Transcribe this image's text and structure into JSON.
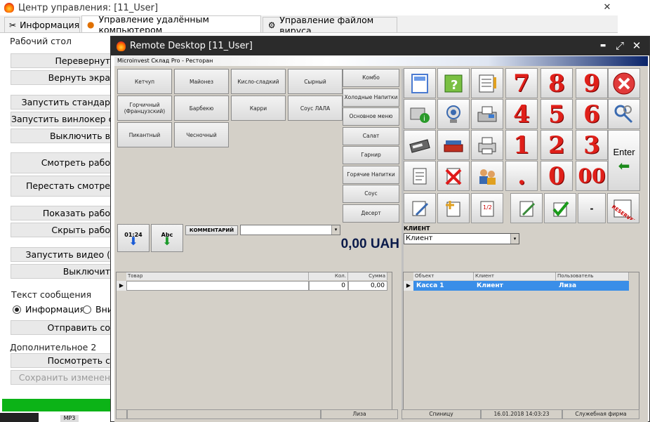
{
  "back_window": {
    "title": "Центр управления: [11_User]",
    "controls": {
      "close": "✕"
    },
    "tabs": [
      {
        "label": "Информация",
        "icon": "tools-icon"
      },
      {
        "label": "Управление удалённым компьютером",
        "icon": "pumpkin-icon"
      },
      {
        "label": "Управление файлом вируса",
        "icon": "gear-icon"
      }
    ],
    "groups": {
      "desktop": "Рабочий стол",
      "message": "Текст сообщения",
      "extra": "Дополнительное 2"
    },
    "buttons": [
      "Перевернут",
      "Вернуть экра",
      "Запустить стандар",
      "Запустить винлокер с",
      "Выключить в",
      "Смотреть рабо",
      "Перестать смотре",
      "Показать рабо",
      "Скрыть рабо",
      "Запустить видео (",
      "Выключит",
      "Отправить со",
      "Посмотреть с",
      "Сохранить изменен"
    ],
    "radio": {
      "selected": "Информация",
      "other": "Вни"
    },
    "taskbar": {
      "label": "MP3"
    },
    "progress_percent": 100
  },
  "rd_window": {
    "title": "Remote Desktop [11_User]",
    "controls": {
      "minimize": "▬",
      "maximize": "⤢",
      "close": "✕"
    },
    "app_title": "Microinvest Склад Pro - Ресторан",
    "products": [
      [
        "Кетчуп",
        "Майонез",
        "Кисло-сладкий",
        "Сырный"
      ],
      [
        "Горчичный (Французский)",
        "Барбекю",
        "Карри",
        "Соус ЛАЛА"
      ],
      [
        "Пикантный",
        "Чесночный"
      ]
    ],
    "categories": [
      "Комбо",
      "Холодные Напитки",
      "Основное меню",
      "Салат",
      "Гарнир",
      "Горячие Напитки",
      "Соус",
      "Десерт"
    ],
    "sort_buttons": {
      "num": "01:24",
      "alpha": "Abc"
    },
    "comment_label": "КОММЕНТАРИЙ",
    "total": "0,00 UAH",
    "client_label": "КЛИЕНТ",
    "client_value": "Клиент",
    "order_grid": {
      "headers": [
        "Товар",
        "Кол.",
        "Сумма"
      ],
      "row": {
        "item": "",
        "qty": "0",
        "sum": "0,00"
      }
    },
    "objects_grid": {
      "headers": [
        "Объект",
        "Клиент",
        "Пользователь"
      ],
      "row": {
        "object": "Касса 1",
        "client": "Клиент",
        "user": "Лиза"
      }
    },
    "keypad": [
      "7",
      "8",
      "9",
      "4",
      "5",
      "6",
      "1",
      "2",
      "3",
      ".",
      "0",
      "00"
    ],
    "enter_label": "Enter",
    "dropdown_label": "-",
    "reserved_label": "RESERVED",
    "status": [
      "Лиза",
      "Спиницу",
      "16.01.2018 14:03:23",
      "Служебная фирма"
    ]
  }
}
